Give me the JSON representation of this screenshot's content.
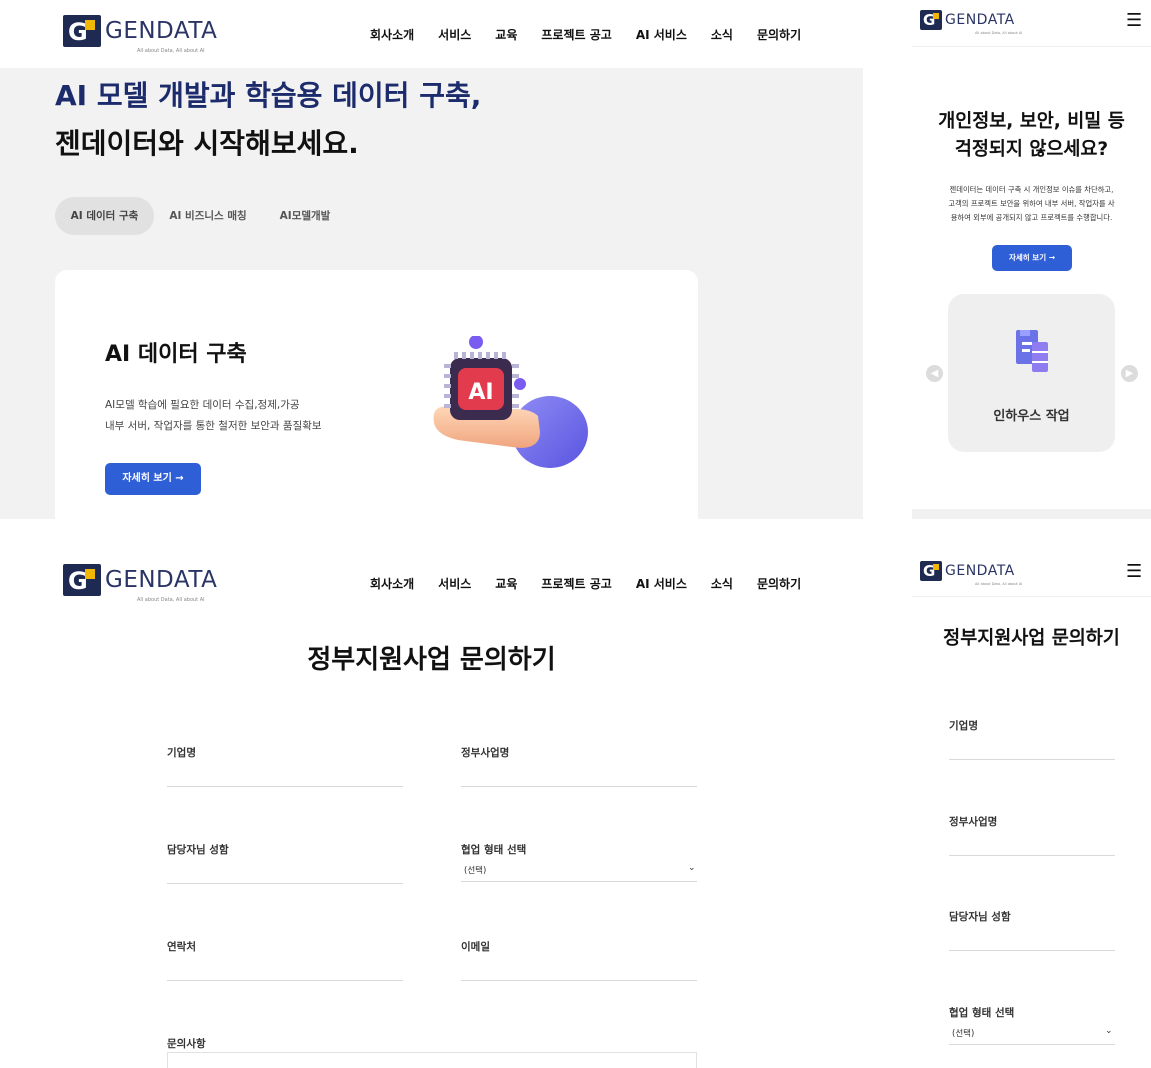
{
  "brand": {
    "name": "GENDATA",
    "tagline": "All about Data, All about AI"
  },
  "nav": [
    "회사소개",
    "서비스",
    "교육",
    "프로젝트 공고",
    "AI 서비스",
    "소식",
    "문의하기"
  ],
  "hero": {
    "line1": "AI 모델 개발과 학습용 데이터 구축,",
    "line2": "젠데이터와 시작해보세요.",
    "tabs": [
      "AI 데이터 구축",
      "AI 비즈니스 매칭",
      "AI모델개발"
    ],
    "card": {
      "title": "AI 데이터 구축",
      "desc1": "AI모델 학습에 필요한 데이터 수집,정제,가공",
      "desc2": "내부 서버, 작업자를 통한 철저한 보안과 품질확보",
      "button": "자세히 보기 →",
      "chip_text": "AI"
    }
  },
  "mobile_security": {
    "title1": "개인정보, 보안, 비밀 등",
    "title2": "걱정되지 않으세요?",
    "desc1": "젠데이터는 데이터 구축 시 개인정보 이슈를 차단하고,",
    "desc2": "고객의 프로젝트 보안을 위하여 내부 서버, 작업자를 사",
    "desc3": "용하여 외부에 공개되지 않고 프로젝트를 수행합니다.",
    "button": "자세히 보기 →",
    "card_label": "인하우스 작업",
    "card_icon": "document-stack-icon"
  },
  "form": {
    "title": "정부지원사업 문의하기",
    "company": "기업명",
    "program": "정부사업명",
    "manager": "담당자님 성함",
    "collab": "협업 형태 선택",
    "collab_value": "(선택)",
    "contact": "연락처",
    "email": "이메일",
    "inquiry": "문의사항"
  },
  "icons": {
    "menu": "hamburger-menu-icon",
    "prev": "arrow-left-icon",
    "next": "arrow-right-icon",
    "select": "chevron-down-icon"
  },
  "colors": {
    "primary": "#2f5fd6",
    "navy": "#1c2b6b",
    "logo_yellow": "#f2b705"
  }
}
